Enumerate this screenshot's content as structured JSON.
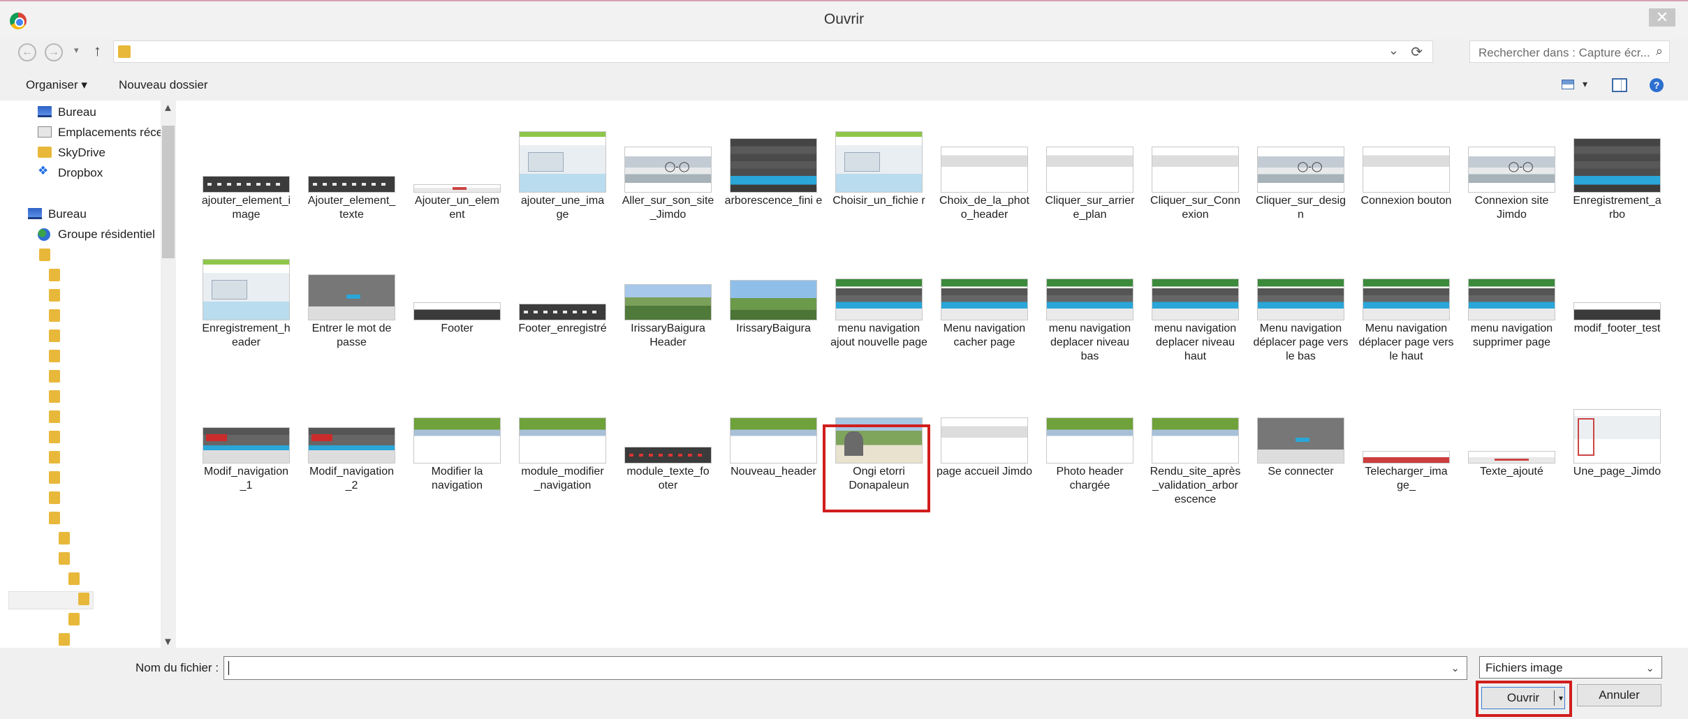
{
  "window": {
    "title": "Ouvrir",
    "close": "✕"
  },
  "nav": {
    "back": "←",
    "forward": "→",
    "dropdown": "▾",
    "up": "↑",
    "chevron": "⌄",
    "refresh": "⟳"
  },
  "search": {
    "placeholder": "Rechercher dans : Capture écr...",
    "icon": "search-icon"
  },
  "toolbar": {
    "organize": "Organiser ▾",
    "new_folder": "Nouveau dossier",
    "view_dropdown": "▾",
    "help": "?"
  },
  "sidebar": {
    "items": [
      {
        "label": "Bureau",
        "icon": "desktop-icon"
      },
      {
        "label": "Emplacements réce",
        "icon": "recent-places-icon"
      },
      {
        "label": "SkyDrive",
        "icon": "folder-icon"
      },
      {
        "label": "Dropbox",
        "icon": "dropbox-icon"
      },
      {
        "label": "Bureau",
        "icon": "desktop-icon"
      },
      {
        "label": "Groupe résidentiel",
        "icon": "homegroup-icon"
      }
    ],
    "scroll_up": "▲",
    "scroll_down": "▼"
  },
  "files": [
    {
      "label": "ajouter_element_i mage",
      "thumb": "dark"
    },
    {
      "label": "Ajouter_element_ texte",
      "thumb": "dark"
    },
    {
      "label": "Ajouter_un_elem ent",
      "thumb": "thin"
    },
    {
      "label": "ajouter_une_ima ge",
      "thumb": "shot"
    },
    {
      "label": "Aller_sur_son_site _Jimdo",
      "thumb": "bike"
    },
    {
      "label": "arborescence_fini e",
      "thumb": "menu"
    },
    {
      "label": "Choisir_un_fichie r",
      "thumb": "shot"
    },
    {
      "label": "Choix_de_la_phot o_header",
      "thumb": "page"
    },
    {
      "label": "Cliquer_sur_arrier e_plan",
      "thumb": "page"
    },
    {
      "label": "Cliquer_sur_Conn exion",
      "thumb": "page"
    },
    {
      "label": "Cliquer_sur_desig n",
      "thumb": "bike"
    },
    {
      "label": "Connexion bouton",
      "thumb": "page"
    },
    {
      "label": "Connexion site Jimdo",
      "thumb": "bike"
    },
    {
      "label": "Enregistrement_a rbo",
      "thumb": "menu"
    },
    {
      "label": "Enregistrement_h eader",
      "thumb": "shot"
    },
    {
      "label": "Entrer le mot de passe",
      "thumb": "gray"
    },
    {
      "label": "Footer",
      "thumb": "footerbar"
    },
    {
      "label": "Footer_enregistré",
      "thumb": "dark"
    },
    {
      "label": "IrissaryBaigura Header",
      "thumb": "landscape"
    },
    {
      "label": "IrissaryBaigura",
      "thumb": "landscape2"
    },
    {
      "label": "menu navigation ajout nouvelle page",
      "thumb": "menunav"
    },
    {
      "label": "Menu navigation cacher page",
      "thumb": "menunav"
    },
    {
      "label": "menu navigation deplacer niveau bas",
      "thumb": "menunav"
    },
    {
      "label": "menu navigation deplacer niveau haut",
      "thumb": "menunav"
    },
    {
      "label": "Menu navigation déplacer page vers le bas",
      "thumb": "menunav"
    },
    {
      "label": "Menu navigation déplacer page vers le haut",
      "thumb": "menunav"
    },
    {
      "label": "menu navigation supprimer page",
      "thumb": "menunav"
    },
    {
      "label": "modif_footer_test",
      "thumb": "footerbar"
    },
    {
      "label": "Modif_navigation _1",
      "thumb": "modnav"
    },
    {
      "label": "Modif_navigation _2",
      "thumb": "modnav"
    },
    {
      "label": "Modifier la navigation",
      "thumb": "header"
    },
    {
      "label": "module_modifier _navigation",
      "thumb": "header"
    },
    {
      "label": "module_texte_fo oter",
      "thumb": "dark red"
    },
    {
      "label": "Nouveau_header",
      "thumb": "header"
    },
    {
      "label": "Ongi etorri Donapaleun",
      "thumb": "ongi"
    },
    {
      "label": "page accueil Jimdo",
      "thumb": "page"
    },
    {
      "label": "Photo header chargée",
      "thumb": "header"
    },
    {
      "label": "Rendu_site_après _validation_arbor escence",
      "thumb": "header"
    },
    {
      "label": "Se connecter",
      "thumb": "gray"
    },
    {
      "label": "Telecharger_ima ge_",
      "thumb": "tele"
    },
    {
      "label": "Texte_ajouté",
      "thumb": "texte"
    },
    {
      "label": "Une_page_Jimdo",
      "thumb": "unepage"
    }
  ],
  "bottom": {
    "filename_label": "Nom du fichier :",
    "filename_value": "",
    "filetype": "Fichiers image",
    "open": "Ouvrir",
    "open_arrow": "▾",
    "cancel": "Annuler",
    "chevron": "⌄"
  }
}
